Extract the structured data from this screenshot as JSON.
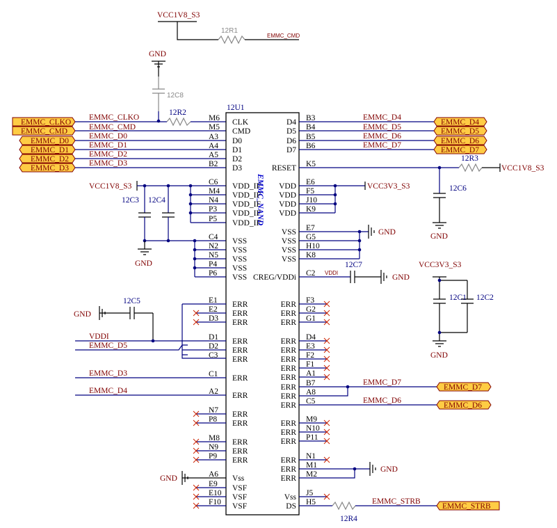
{
  "chip": {
    "designator": "12U1",
    "type_label": "EMMC_NAND",
    "left_pins": [
      {
        "num": "M6",
        "name": "CLK",
        "net": "EMMC_CLKO"
      },
      {
        "num": "M5",
        "name": "CMD",
        "net": "EMMC_CMD"
      },
      {
        "num": "A3",
        "name": "D0",
        "net": "EMMC_D0"
      },
      {
        "num": "A4",
        "name": "D1",
        "net": "EMMC_D1"
      },
      {
        "num": "A5",
        "name": "D2",
        "net": "EMMC_D2"
      },
      {
        "num": "B2",
        "name": "D3",
        "net": "EMMC_D3"
      },
      {
        "num": "C6",
        "name": "VDD_IF",
        "net": ""
      },
      {
        "num": "M4",
        "name": "VDD_IF",
        "net": ""
      },
      {
        "num": "N4",
        "name": "VDD_IF",
        "net": ""
      },
      {
        "num": "P3",
        "name": "VDD_IF",
        "net": ""
      },
      {
        "num": "P5",
        "name": "VDD_IF",
        "net": ""
      },
      {
        "num": "C4",
        "name": "VSS",
        "net": ""
      },
      {
        "num": "N2",
        "name": "VSS",
        "net": ""
      },
      {
        "num": "N5",
        "name": "VSS",
        "net": ""
      },
      {
        "num": "P4",
        "name": "VSS",
        "net": ""
      },
      {
        "num": "P6",
        "name": "VSS",
        "net": ""
      },
      {
        "num": "E1",
        "name": "ERR",
        "net": ""
      },
      {
        "num": "E2",
        "name": "ERR",
        "net": ""
      },
      {
        "num": "D3",
        "name": "ERR",
        "net": ""
      },
      {
        "num": "D1",
        "name": "ERR",
        "net": "VDDI"
      },
      {
        "num": "D2",
        "name": "ERR",
        "net": "EMMC_D5"
      },
      {
        "num": "C3",
        "name": "ERR",
        "net": ""
      },
      {
        "num": "C1",
        "name": "ERR",
        "net": "EMMC_D3"
      },
      {
        "num": "A2",
        "name": "ERR",
        "net": "EMMC_D4"
      },
      {
        "num": "N7",
        "name": "ERR",
        "net": ""
      },
      {
        "num": "P8",
        "name": "ERR",
        "net": ""
      },
      {
        "num": "M8",
        "name": "ERR",
        "net": ""
      },
      {
        "num": "N9",
        "name": "ERR",
        "net": ""
      },
      {
        "num": "P9",
        "name": "ERR",
        "net": ""
      },
      {
        "num": "A6",
        "name": "Vss",
        "net": ""
      },
      {
        "num": "E9",
        "name": "VSF",
        "net": ""
      },
      {
        "num": "E10",
        "name": "VSF",
        "net": ""
      },
      {
        "num": "F10",
        "name": "VSF",
        "net": ""
      }
    ],
    "right_pins": [
      {
        "num": "B3",
        "name": "D4",
        "net": "EMMC_D4"
      },
      {
        "num": "B4",
        "name": "D5",
        "net": "EMMC_D5"
      },
      {
        "num": "B5",
        "name": "D6",
        "net": "EMMC_D6"
      },
      {
        "num": "B6",
        "name": "D7",
        "net": "EMMC_D7"
      },
      {
        "num": "K5",
        "name": "RESET",
        "net": ""
      },
      {
        "num": "E6",
        "name": "VDD",
        "net": ""
      },
      {
        "num": "F5",
        "name": "VDD",
        "net": ""
      },
      {
        "num": "J10",
        "name": "VDD",
        "net": ""
      },
      {
        "num": "K9",
        "name": "VDD",
        "net": ""
      },
      {
        "num": "E7",
        "name": "VSS",
        "net": ""
      },
      {
        "num": "G5",
        "name": "VSS",
        "net": ""
      },
      {
        "num": "H10",
        "name": "VSS",
        "net": ""
      },
      {
        "num": "K8",
        "name": "VSS",
        "net": ""
      },
      {
        "num": "C2",
        "name": "CREG/VDDi",
        "net": "VDDI"
      },
      {
        "num": "F3",
        "name": "ERR",
        "net": ""
      },
      {
        "num": "G2",
        "name": "ERR",
        "net": ""
      },
      {
        "num": "G1",
        "name": "ERR",
        "net": ""
      },
      {
        "num": "D4",
        "name": "ERR",
        "net": ""
      },
      {
        "num": "E3",
        "name": "ERR",
        "net": ""
      },
      {
        "num": "F2",
        "name": "ERR",
        "net": ""
      },
      {
        "num": "F1",
        "name": "ERR",
        "net": ""
      },
      {
        "num": "A1",
        "name": "ERR",
        "net": ""
      },
      {
        "num": "B7",
        "name": "ERR",
        "net": "EMMC_D7"
      },
      {
        "num": "A8",
        "name": "ERR",
        "net": ""
      },
      {
        "num": "C5",
        "name": "ERR",
        "net": "EMMC_D6"
      },
      {
        "num": "M9",
        "name": "ERR",
        "net": ""
      },
      {
        "num": "N10",
        "name": "ERR",
        "net": ""
      },
      {
        "num": "P11",
        "name": "ERR",
        "net": ""
      },
      {
        "num": "N1",
        "name": "ERR",
        "net": ""
      },
      {
        "num": "M1",
        "name": "ERR",
        "net": ""
      },
      {
        "num": "M2",
        "name": "ERR",
        "net": ""
      },
      {
        "num": "J5",
        "name": "Vss",
        "net": ""
      },
      {
        "num": "H5",
        "name": "DS",
        "net": "EMMC_STRB"
      }
    ]
  },
  "ports_left": [
    "EMMC_CLKO",
    "EMMC_CMD",
    "EMMC_D0",
    "EMMC_D1",
    "EMMC_D2",
    "EMMC_D3"
  ],
  "ports_right": [
    "EMMC_D4",
    "EMMC_D5",
    "EMMC_D6",
    "EMMC_D7"
  ],
  "ports_right_lower": [
    "EMMC_D7",
    "EMMC_D6",
    "EMMC_STRB"
  ],
  "power": {
    "vcc1v8": "VCC1V8_S3",
    "vcc3v3": "VCC3V3_S3",
    "gnd": "GND",
    "vddi": "VDDI"
  },
  "parts": {
    "r1": "12R1",
    "r2": "12R2",
    "r3": "12R3",
    "r4": "12R4",
    "c1": "12C1",
    "c2": "12C2",
    "c3": "12C3",
    "c4": "12C4",
    "c5": "12C5",
    "c6": "12C6",
    "c7": "12C7",
    "c8": "12C8"
  },
  "net_labels": {
    "emmc_cmd_top": "EMMC_CMD",
    "emmc_strb": "EMMC_STRB",
    "vddi_small": "VDDI"
  },
  "colors": {
    "wire": "#000080",
    "net": "#800000",
    "port_fill": "#ffcc44",
    "nc_mark": "#cc2200"
  }
}
